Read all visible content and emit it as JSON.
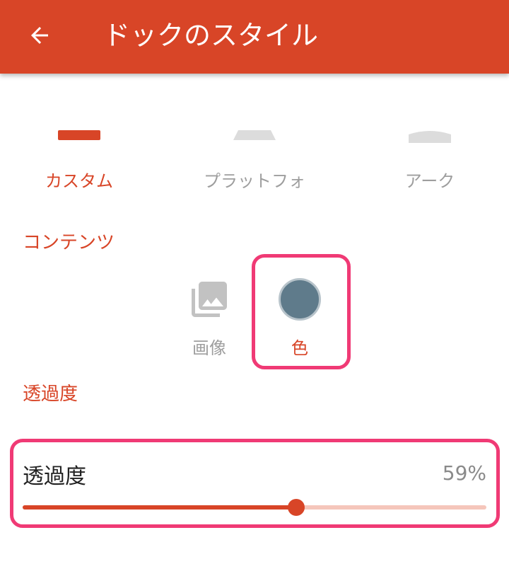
{
  "appbar": {
    "title": "ドックのスタイル",
    "back_icon": "arrow-back-icon",
    "color": "#d84527"
  },
  "dock_styles": [
    {
      "label": "カスタム",
      "icon": "flat-bar-icon",
      "selected": true
    },
    {
      "label": "プラットフォ",
      "icon": "platform-trapezoid-icon",
      "selected": false
    },
    {
      "label": "アーク",
      "icon": "arc-shape-icon",
      "selected": false
    }
  ],
  "contents_section": {
    "header": "コンテンツ",
    "options": [
      {
        "label": "画像",
        "icon": "image-stack-icon",
        "selected": false
      },
      {
        "label": "色",
        "icon": "color-circle-icon",
        "color": "#5f7b8b",
        "selected": true
      }
    ]
  },
  "transparency_section": {
    "header": "透過度",
    "slider": {
      "title": "透過度",
      "value_text": "59%",
      "value_fraction": 0.59
    }
  },
  "colors": {
    "accent": "#d84527",
    "inactive": "#9e9e9e",
    "highlight": "#f03a75",
    "track_inactive": "#f5c6bb"
  }
}
